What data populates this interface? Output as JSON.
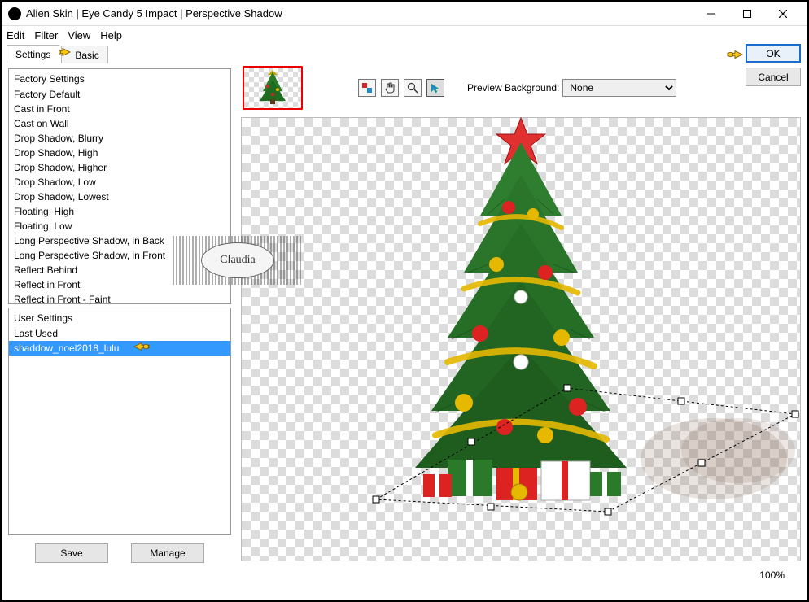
{
  "title": "Alien Skin | Eye Candy 5 Impact | Perspective Shadow",
  "menu": {
    "edit": "Edit",
    "filter": "Filter",
    "view": "View",
    "help": "Help"
  },
  "tabs": {
    "settings": "Settings",
    "basic": "Basic"
  },
  "factory": {
    "header": "Factory Settings",
    "items": [
      "Factory Default",
      "Cast in Front",
      "Cast on Wall",
      "Drop Shadow, Blurry",
      "Drop Shadow, High",
      "Drop Shadow, Higher",
      "Drop Shadow, Low",
      "Drop Shadow, Lowest",
      "Floating, High",
      "Floating, Low",
      "Long Perspective Shadow, in Back",
      "Long Perspective Shadow, in Front",
      "Reflect Behind",
      "Reflect in Front",
      "Reflect in Front - Faint"
    ]
  },
  "user": {
    "header": "User Settings",
    "items": [
      {
        "label": "Last Used",
        "selected": false
      },
      {
        "label": "shaddow_noel2018_lulu",
        "selected": true
      }
    ]
  },
  "buttons": {
    "save": "Save",
    "manage": "Manage",
    "ok": "OK",
    "cancel": "Cancel"
  },
  "preview": {
    "label": "Preview Background:",
    "value": "None"
  },
  "zoom": "100%",
  "claudia": "Claudia"
}
